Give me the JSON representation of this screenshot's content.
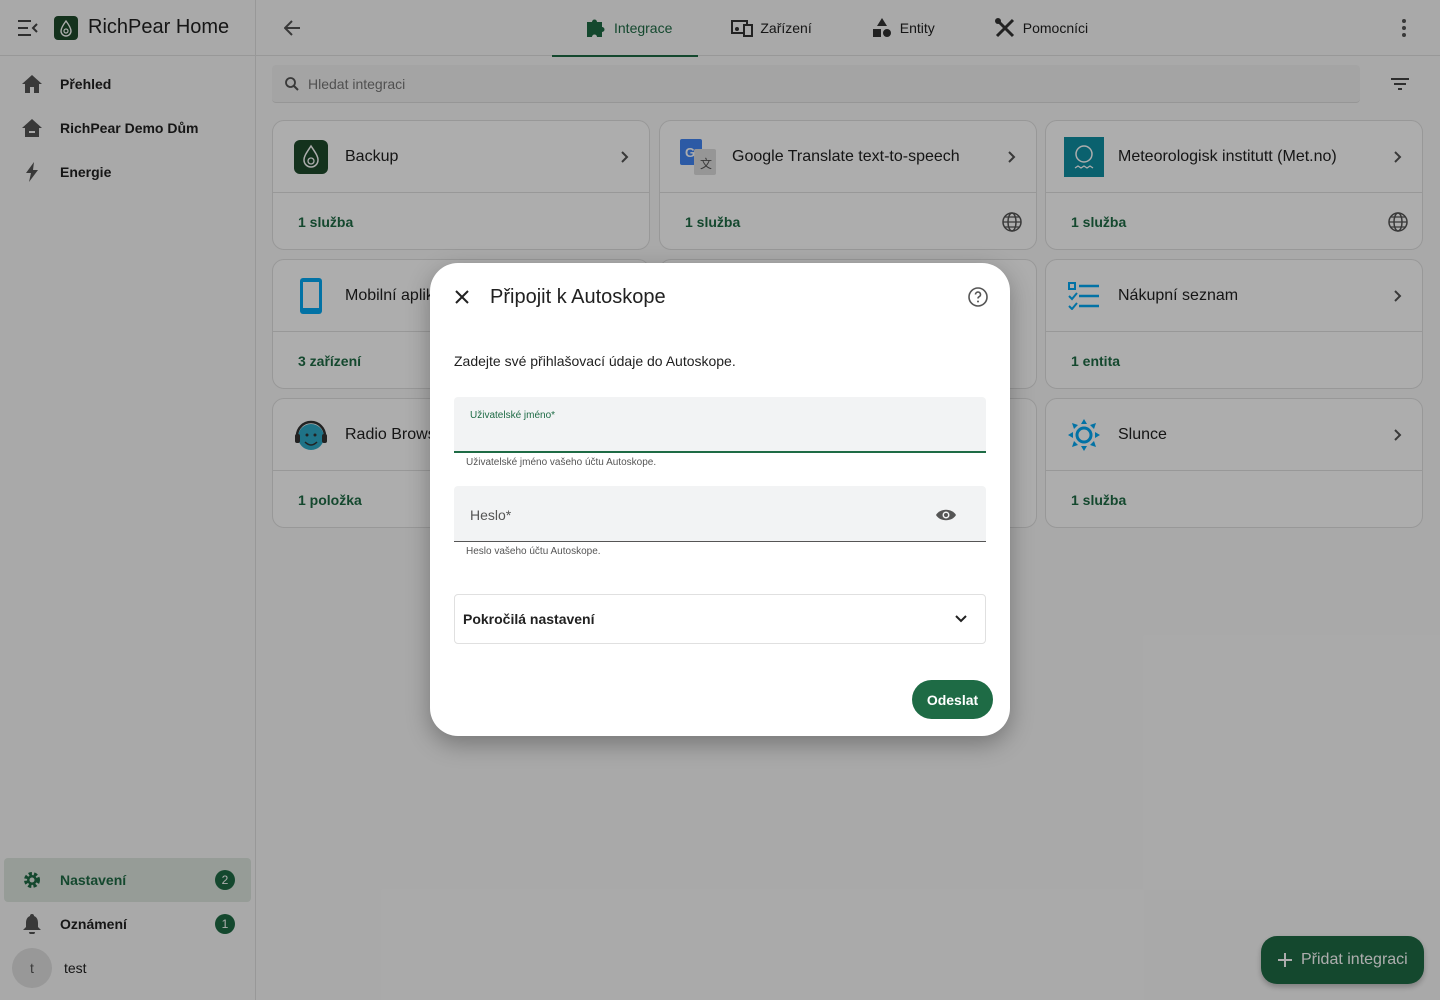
{
  "app": {
    "title": "RichPear Home"
  },
  "sidebar": {
    "items": [
      {
        "label": "Přehled",
        "icon": "home-icon"
      },
      {
        "label": "RichPear Demo Dům",
        "icon": "home-variant-icon"
      },
      {
        "label": "Energie",
        "icon": "lightning-icon"
      }
    ],
    "bottom": [
      {
        "label": "Nastavení",
        "icon": "gear-icon",
        "badge": "2"
      },
      {
        "label": "Oznámení",
        "icon": "bell-icon",
        "badge": "1"
      }
    ],
    "user": {
      "initial": "t",
      "name": "test"
    }
  },
  "tabs": [
    {
      "label": "Integrace",
      "icon": "puzzle-icon",
      "active": true
    },
    {
      "label": "Zařízení",
      "icon": "devices-icon",
      "active": false
    },
    {
      "label": "Entity",
      "icon": "shapes-icon",
      "active": false
    },
    {
      "label": "Pomocníci",
      "icon": "tools-icon",
      "active": false
    }
  ],
  "search": {
    "placeholder": "Hledat integraci"
  },
  "cards": [
    {
      "name": "Backup",
      "link": "1 služba",
      "cloud": false
    },
    {
      "name": "Google Translate text-to-speech",
      "link": "1 služba",
      "cloud": true
    },
    {
      "name": "Meteorologisk institutt (Met.no)",
      "link": "1 služba",
      "cloud": true
    },
    {
      "name": "Mobilní aplikace",
      "link": "3 zařízení",
      "cloud": false
    },
    {
      "name": "Nákupní seznam",
      "link": "1 entita",
      "cloud": false
    },
    {
      "name": "Radio Browser",
      "link": "1 položka",
      "cloud": false
    },
    {
      "name": "Slunce",
      "link": "1 služba",
      "cloud": false
    }
  ],
  "fab": {
    "label": "Přidat integraci"
  },
  "dialog": {
    "title": "Připojit k Autoskope",
    "description": "Zadejte své přihlašovací údaje do Autoskope.",
    "username": {
      "label": "Uživatelské jméno*",
      "helper": "Uživatelské jméno vašeho účtu Autoskope.",
      "value": ""
    },
    "password": {
      "label": "Heslo*",
      "helper": "Heslo vašeho účtu Autoskope.",
      "value": ""
    },
    "advanced": "Pokročilá nastavení",
    "submit": "Odeslat"
  },
  "colors": {
    "primary": "#1e6b45",
    "overlay": "rgba(0,0,0,0.32)"
  }
}
